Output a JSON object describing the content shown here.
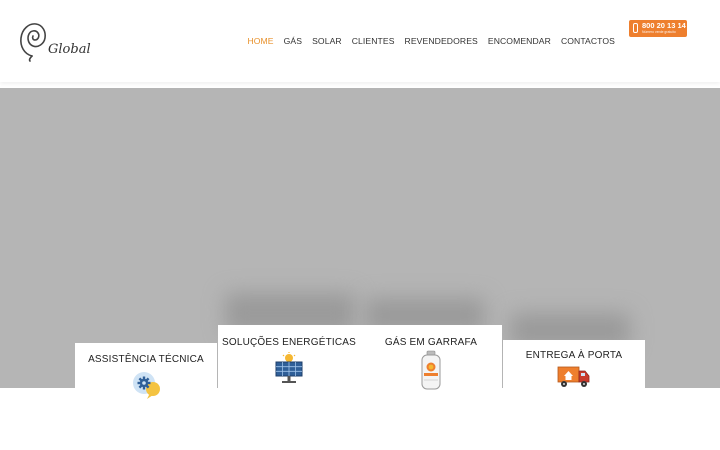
{
  "header": {
    "logo_text": "Global",
    "nav": [
      {
        "label": "HOME",
        "active": true
      },
      {
        "label": "GÁS"
      },
      {
        "label": "SOLAR"
      },
      {
        "label": "CLIENTES"
      },
      {
        "label": "REVENDEDORES"
      },
      {
        "label": "ENCOMENDAR"
      },
      {
        "label": "CONTACTOS"
      }
    ],
    "phone": {
      "number": "800 20 13 14",
      "sub": "Número verde gratuito"
    }
  },
  "services": [
    {
      "title": "ASSISTÊNCIA TÉCNICA",
      "icon": "support-chat-gear-icon"
    },
    {
      "title": "SOLUÇÕES ENERGÉTICAS",
      "icon": "solar-panel-icon"
    },
    {
      "title": "GÁS EM GARRAFA",
      "icon": "gas-bottle-icon"
    },
    {
      "title": "ENTREGA À PORTA",
      "icon": "delivery-truck-icon"
    }
  ],
  "colors": {
    "accent": "#e8912c",
    "phone_bg": "#ee7f2e",
    "hero_bg": "#b5b5b5"
  }
}
